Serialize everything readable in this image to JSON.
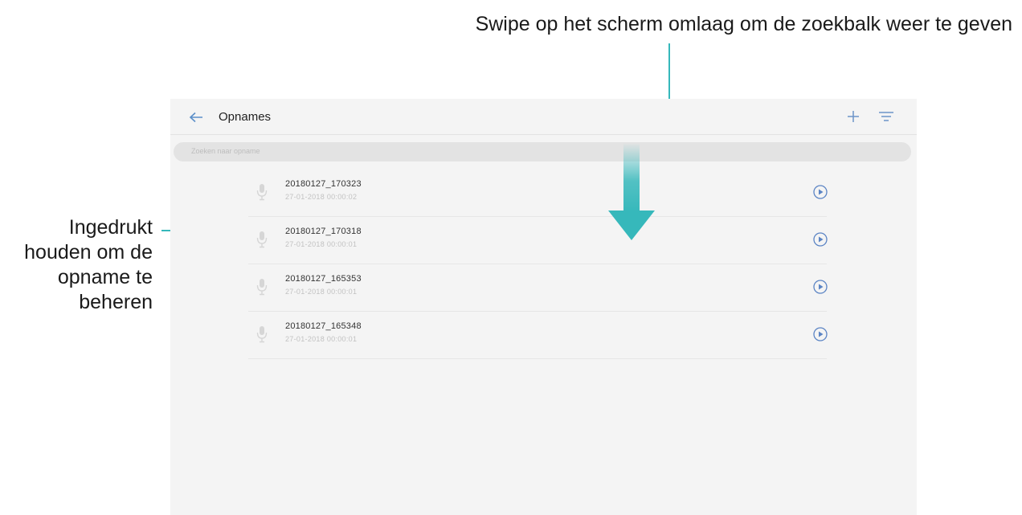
{
  "annotations": {
    "top": "Swipe op het scherm omlaag om de zoekbalk weer te geven",
    "left": "Ingedrukt houden om de opname te beheren"
  },
  "app": {
    "title": "Opnames",
    "back_icon": "arrow-left-icon",
    "add_icon": "plus-icon",
    "sort_icon": "sort-icon"
  },
  "search": {
    "placeholder": "Zoeken naar opname"
  },
  "recordings": [
    {
      "name": "20180127_170323",
      "meta": "27-01-2018   00:00:02"
    },
    {
      "name": "20180127_170318",
      "meta": "27-01-2018   00:00:01"
    },
    {
      "name": "20180127_165353",
      "meta": "27-01-2018   00:00:01"
    },
    {
      "name": "20180127_165348",
      "meta": "27-01-2018   00:00:01"
    }
  ],
  "colors": {
    "accent": "#36b8bb",
    "play_icon": "#5b84c4",
    "screen_bg": "#f4f4f4",
    "search_bg": "#e3e3e3"
  }
}
